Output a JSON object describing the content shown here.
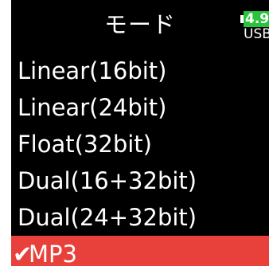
{
  "header": {
    "title": "モード",
    "battery": {
      "level_text": "4.9",
      "source_text": "USB",
      "color": "#29c43a"
    }
  },
  "menu": {
    "selected_color": "#e8403a",
    "items": [
      {
        "label": "Linear(16bit)",
        "selected": false
      },
      {
        "label": "Linear(24bit)",
        "selected": false
      },
      {
        "label": "Float(32bit)",
        "selected": false
      },
      {
        "label": "Dual(16+32bit)",
        "selected": false
      },
      {
        "label": "Dual(24+32bit)",
        "selected": false
      },
      {
        "label": "MP3",
        "selected": true,
        "check": "✔"
      }
    ]
  }
}
